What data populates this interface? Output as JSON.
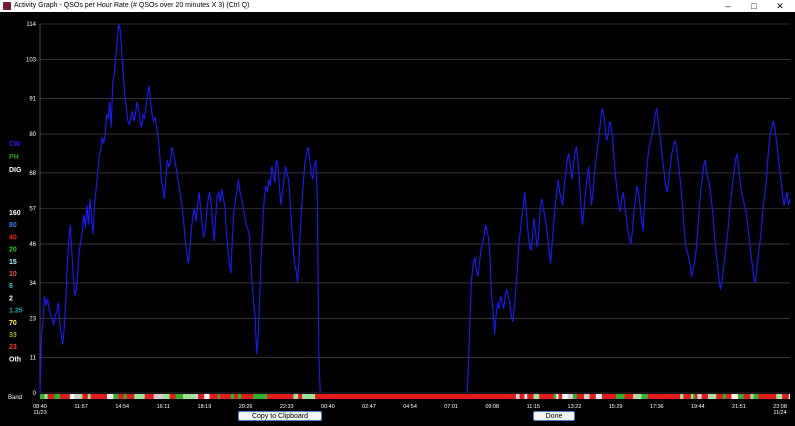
{
  "window": {
    "title": "Activity Graph - QSOs per Hour Rate   (# QSOs over 20 minutes X 3)  (Ctrl Q)",
    "min_icon": "minimize-icon",
    "max_icon": "maximize-icon",
    "close_icon": "close-icon"
  },
  "buttons": {
    "copy": "Copy to Clipboard",
    "done": "Done"
  },
  "mode_legend": [
    {
      "label": "CW",
      "color": "#1f1fff"
    },
    {
      "label": "PH",
      "color": "#1ea01e"
    },
    {
      "label": "DIG",
      "color": "#ffffff"
    }
  ],
  "band_legend": [
    {
      "label": "160",
      "color": "#ffffff"
    },
    {
      "label": "80",
      "color": "#3a7dff"
    },
    {
      "label": "40",
      "color": "#ff2020"
    },
    {
      "label": "20",
      "color": "#20d020"
    },
    {
      "label": "15",
      "color": "#a0ffff"
    },
    {
      "label": "10",
      "color": "#ff5050"
    },
    {
      "label": "6",
      "color": "#40c0c0"
    },
    {
      "label": "2",
      "color": "#ffffff"
    },
    {
      "label": "1.25",
      "color": "#20a0a0"
    },
    {
      "label": "70",
      "color": "#ffff40"
    },
    {
      "label": "33",
      "color": "#90c020"
    },
    {
      "label": "23",
      "color": "#ff3030"
    },
    {
      "label": "Oth",
      "color": "#ffffff"
    }
  ],
  "band_axis_label": "Band",
  "chart_data": {
    "type": "line",
    "series": [
      {
        "color": "#1a1aff",
        "values": [
          0,
          18,
          22,
          30,
          27,
          29,
          26,
          24,
          23,
          21,
          24,
          25,
          28,
          22,
          18,
          15,
          20,
          28,
          40,
          47,
          52,
          44,
          36,
          30,
          32,
          38,
          44,
          47,
          50,
          55,
          51,
          58,
          52,
          60,
          55,
          49,
          58,
          63,
          68,
          73,
          75,
          79,
          77,
          80,
          86,
          85,
          90,
          82,
          96,
          98,
          104,
          109,
          114,
          112,
          105,
          98,
          92,
          88,
          84,
          83,
          85,
          87,
          84,
          86,
          90,
          88,
          84,
          82,
          86,
          85,
          89,
          92,
          95,
          90,
          86,
          84,
          85,
          82,
          79,
          74,
          66,
          64,
          60,
          66,
          72,
          70,
          71,
          76,
          74,
          72,
          69,
          66,
          63,
          60,
          57,
          52,
          46,
          43,
          40,
          45,
          51,
          55,
          57,
          53,
          58,
          62,
          57,
          52,
          48,
          50,
          56,
          60,
          62,
          58,
          52,
          47,
          55,
          61,
          62,
          59,
          63,
          60,
          58,
          50,
          44,
          40,
          37,
          48,
          56,
          60,
          62,
          66,
          62,
          60,
          58,
          55,
          52,
          51,
          49,
          42,
          34,
          28,
          23,
          12,
          18,
          30,
          42,
          52,
          60,
          64,
          62,
          66,
          64,
          70,
          68,
          65,
          72,
          70,
          64,
          58,
          62,
          66,
          70,
          68,
          66,
          60,
          52,
          46,
          40,
          38,
          34,
          42,
          52,
          60,
          66,
          72,
          74,
          76,
          72,
          68,
          66,
          70,
          72,
          60,
          12,
          0,
          null,
          null,
          null,
          null,
          null,
          null,
          null,
          null,
          null,
          null,
          null,
          null,
          null,
          null,
          null,
          null,
          null,
          null,
          null,
          null,
          null,
          null,
          null,
          null,
          null,
          null,
          null,
          null,
          null,
          null,
          null,
          null,
          null,
          null,
          null,
          null,
          null,
          null,
          null,
          null,
          null,
          null,
          null,
          null,
          null,
          null,
          null,
          null,
          null,
          null,
          null,
          null,
          null,
          null,
          null,
          null,
          null,
          null,
          null,
          null,
          null,
          null,
          null,
          null,
          null,
          null,
          null,
          null,
          null,
          null,
          null,
          null,
          null,
          null,
          null,
          null,
          null,
          null,
          null,
          null,
          null,
          null,
          null,
          null,
          null,
          null,
          null,
          null,
          null,
          null,
          null,
          null,
          null,
          null,
          null,
          null,
          0,
          12,
          26,
          36,
          40,
          42,
          38,
          36,
          40,
          44,
          46,
          48,
          52,
          50,
          48,
          42,
          30,
          26,
          18,
          24,
          28,
          26,
          30,
          28,
          26,
          30,
          32,
          30,
          28,
          24,
          22,
          26,
          32,
          38,
          46,
          50,
          54,
          58,
          62,
          56,
          50,
          46,
          44,
          48,
          54,
          50,
          45,
          48,
          56,
          60,
          58,
          55,
          52,
          48,
          44,
          40,
          46,
          52,
          58,
          62,
          66,
          62,
          60,
          58,
          64,
          68,
          72,
          74,
          70,
          66,
          70,
          74,
          76,
          72,
          66,
          58,
          52,
          56,
          62,
          66,
          70,
          64,
          58,
          62,
          68,
          72,
          76,
          80,
          84,
          88,
          86,
          82,
          78,
          80,
          84,
          82,
          78,
          72,
          66,
          62,
          58,
          56,
          60,
          62,
          58,
          54,
          50,
          48,
          46,
          50,
          56,
          60,
          64,
          62,
          58,
          54,
          50,
          58,
          66,
          72,
          76,
          78,
          80,
          82,
          86,
          88,
          84,
          80,
          76,
          72,
          68,
          64,
          62,
          66,
          70,
          74,
          76,
          78,
          76,
          72,
          68,
          64,
          58,
          52,
          46,
          44,
          42,
          40,
          36,
          38,
          40,
          44,
          50,
          56,
          62,
          66,
          70,
          72,
          68,
          66,
          64,
          60,
          56,
          50,
          44,
          40,
          36,
          32,
          34,
          38,
          42,
          46,
          50,
          56,
          60,
          64,
          68,
          72,
          74,
          70,
          66,
          62,
          60,
          58,
          56,
          52,
          48,
          44,
          40,
          36,
          34,
          38,
          42,
          46,
          50,
          56,
          60,
          64,
          70,
          76,
          80,
          82,
          84,
          82,
          78,
          74,
          70,
          66,
          62,
          58,
          60,
          62,
          58,
          60
        ]
      }
    ],
    "ylim": [
      0,
      114
    ],
    "y_ticks": [
      "0",
      "11",
      "23",
      "34",
      "46",
      "57",
      "68",
      "80",
      "91",
      "103",
      "114"
    ],
    "x_ticks": [
      {
        "label": "08:40",
        "sub": "11/23"
      },
      {
        "label": "11:57"
      },
      {
        "label": "14:54"
      },
      {
        "label": "16:11"
      },
      {
        "label": "18:19"
      },
      {
        "label": "20:26"
      },
      {
        "label": "22:33"
      },
      {
        "label": "00:40"
      },
      {
        "label": "02:47"
      },
      {
        "label": "04:54"
      },
      {
        "label": "07:01"
      },
      {
        "label": "09:08"
      },
      {
        "label": "11:15"
      },
      {
        "label": "13:22"
      },
      {
        "label": "15:29"
      },
      {
        "label": "17:36"
      },
      {
        "label": "19:44"
      },
      {
        "label": "21:51"
      },
      {
        "label": "23:08",
        "sub": "11/24"
      }
    ],
    "grid": true
  }
}
